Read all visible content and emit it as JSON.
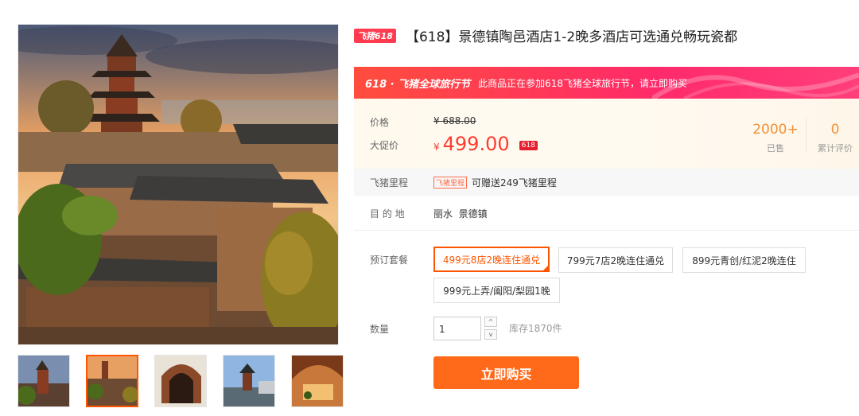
{
  "product": {
    "fz_tag": "飞猪618",
    "title": "【618】景德镇陶邑酒店1-2晚多酒店可选通兑畅玩瓷都"
  },
  "banner": {
    "logo": "618 · 飞猪全球旅行节",
    "text": "此商品正在参加618飞猪全球旅行节，请立即购买"
  },
  "price": {
    "label": "价格",
    "original": "¥ 688.00",
    "sale_label": "大促价",
    "currency": "¥",
    "sale_value": "499.00",
    "tag": "618"
  },
  "stats": {
    "sold_num": "2000+",
    "sold_label": "已售",
    "reviews_num": "0",
    "reviews_label": "累计评价"
  },
  "mileage": {
    "label": "飞猪里程",
    "tag": "飞猪里程",
    "text": "可赠送249飞猪里程"
  },
  "destination": {
    "label": "目 的 地",
    "value": "丽水  景德镇"
  },
  "packages": {
    "label": "预订套餐",
    "options": [
      "499元8店2晚连住通兑",
      "799元7店2晚连住通兑",
      "899元青创/红泥2晚连住",
      "999元上弄/阖阳/梨园1晚"
    ],
    "selected_index": 0
  },
  "quantity": {
    "label": "数量",
    "value": "1",
    "up": "^",
    "down": "v",
    "stock": "库存1870件"
  },
  "buy_button": "立即购买",
  "colors": {
    "accent": "#ff5500",
    "price_red": "#ff3b30",
    "banner": "#ff2a6a",
    "stat_orange": "#f29137"
  }
}
